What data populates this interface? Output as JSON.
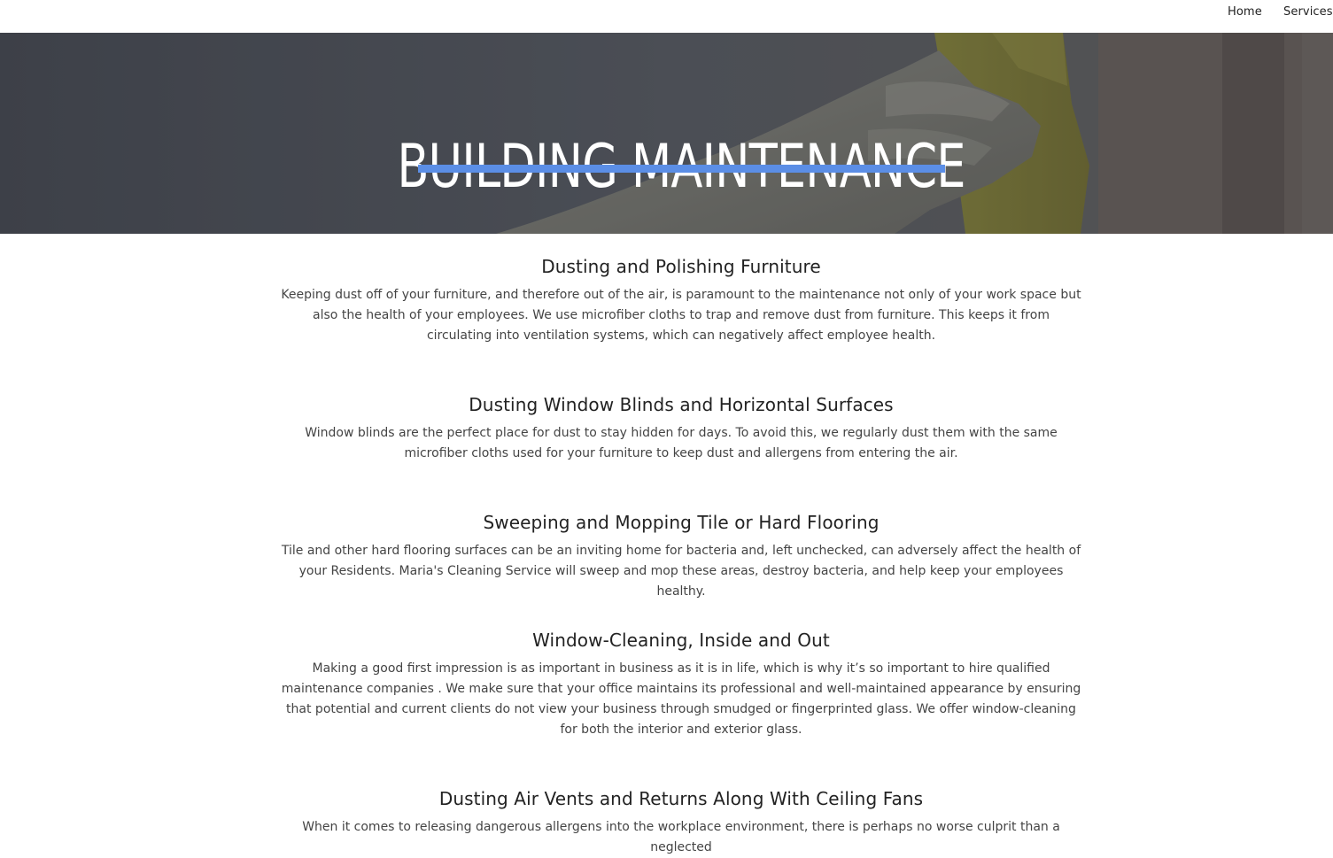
{
  "nav": {
    "home": "Home",
    "services": "Services"
  },
  "hero": {
    "title": "BUILDING MAINTENANCE",
    "underline_color": "#5b8ee6"
  },
  "services": [
    {
      "title": "Dusting and Polishing Furniture",
      "text": "Keeping dust off of your furniture, and therefore out of the air, is paramount to the maintenance not only of your work space but also the health of your employees. We use microfiber cloths to trap and remove dust from furniture. This keeps it from circulating into ventilation systems, which can negatively affect employee health."
    },
    {
      "title": "Dusting Window Blinds and Horizontal Surfaces",
      "text": "Window blinds are the perfect place for dust to stay hidden for days. To avoid this, we regularly dust them with the same microfiber cloths used for your furniture to keep dust and allergens from entering the air."
    },
    {
      "title": "Sweeping and Mopping Tile or Hard Flooring",
      "text": "Tile and other hard flooring surfaces can be an inviting home for bacteria and, left unchecked, can adversely affect the health of your Residents. Maria's Cleaning Service will sweep and mop these areas, destroy bacteria, and help keep your employees healthy."
    },
    {
      "title": "Window-Cleaning, Inside and Out",
      "text": "Making a good first impression is as important in business as it is in life, which is why it’s so important to hire qualified maintenance companies . We make sure that your office maintains its professional and well-maintained appearance by ensuring that potential and current clients do not view your business through smudged or fingerprinted glass. We offer window-cleaning for both the interior and exterior glass."
    },
    {
      "title": "Dusting Air Vents and Returns Along With Ceiling Fans",
      "text": "When it comes to releasing dangerous allergens into the workplace environment, there is perhaps no worse culprit than a neglected"
    }
  ]
}
